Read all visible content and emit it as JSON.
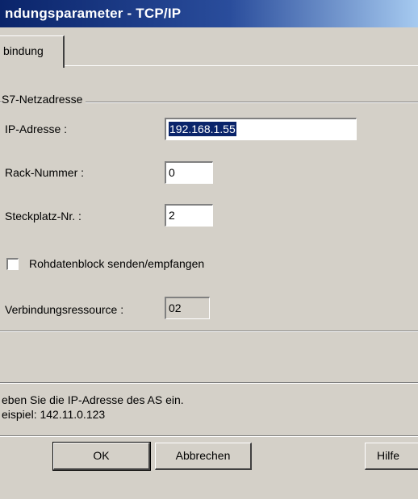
{
  "window": {
    "title": "ndungsparameter - TCP/IP"
  },
  "tabs": [
    {
      "label": "bindung"
    }
  ],
  "group": {
    "label": "S7-Netzadresse"
  },
  "fields": {
    "ip_label": "IP-Adresse :",
    "ip_value": "192.168.1.55",
    "rack_label": "Rack-Nummer :",
    "rack_value": "0",
    "slot_label": "Steckplatz-Nr. :",
    "slot_value": "2",
    "resource_label": "Verbindungsressource :",
    "resource_value": "02"
  },
  "checkbox": {
    "label": "Rohdatenblock senden/empfangen",
    "checked": false
  },
  "hint": {
    "line1": "eben Sie die IP-Adresse des AS ein.",
    "line2": "eispiel: 142.11.0.123"
  },
  "buttons": {
    "ok": "OK",
    "cancel": "Abbrechen",
    "help": "Hilfe"
  }
}
